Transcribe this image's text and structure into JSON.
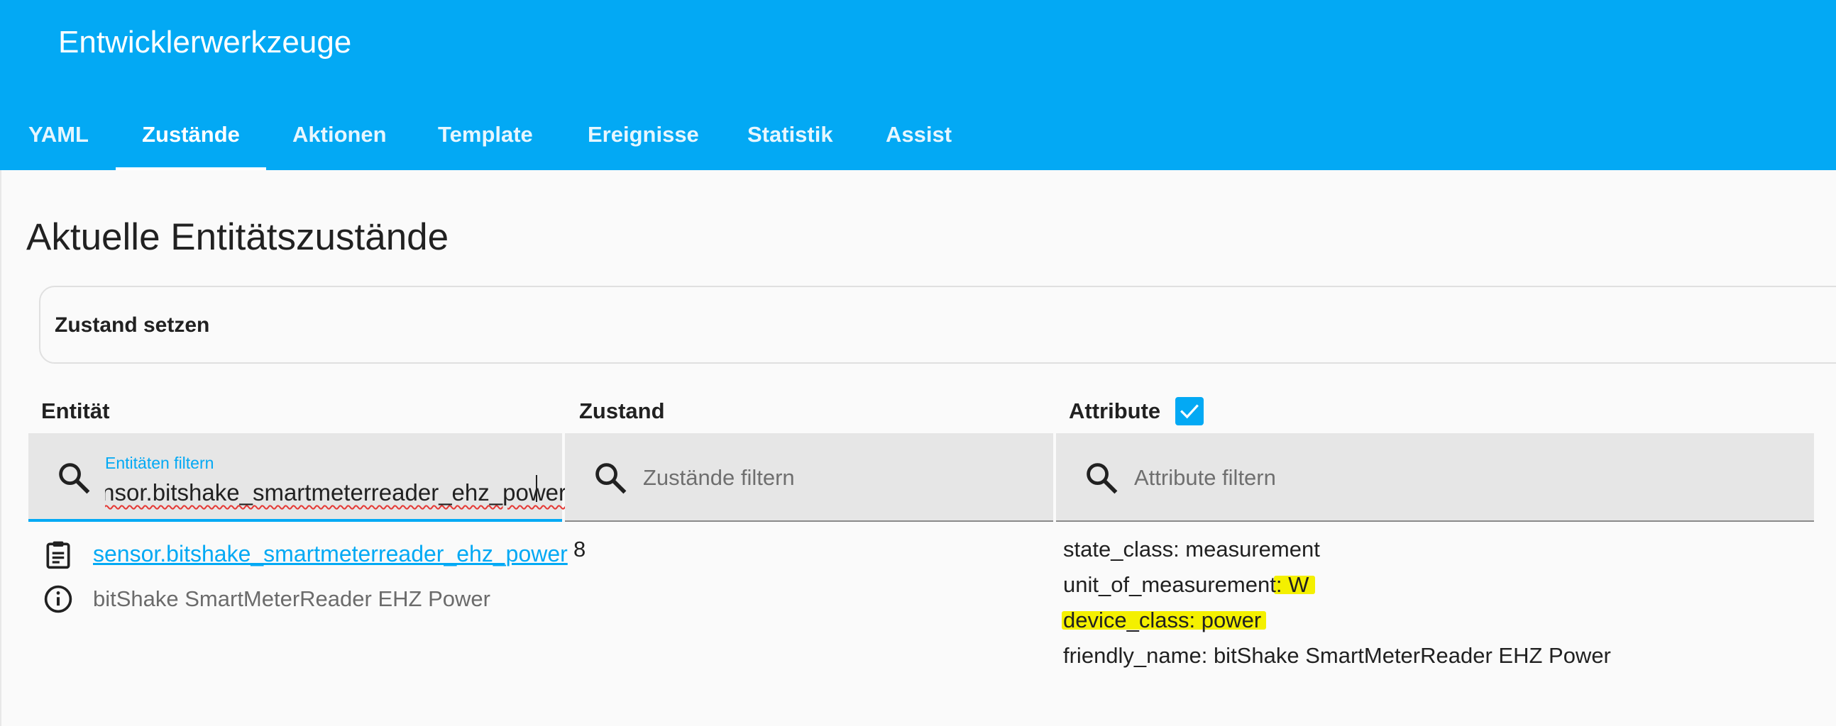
{
  "header": {
    "title": "Entwicklerwerkzeuge",
    "tabs": [
      {
        "label": "YAML",
        "active": false
      },
      {
        "label": "Zustände",
        "active": true
      },
      {
        "label": "Aktionen",
        "active": false
      },
      {
        "label": "Template",
        "active": false
      },
      {
        "label": "Ereignisse",
        "active": false
      },
      {
        "label": "Statistik",
        "active": false
      },
      {
        "label": "Assist",
        "active": false
      }
    ]
  },
  "page": {
    "title": "Aktuelle Entitätszustände",
    "set_state_label": "Zustand setzen"
  },
  "table": {
    "columns": {
      "entity": "Entität",
      "state": "Zustand",
      "attributes": "Attribute"
    },
    "attributes_checkbox_checked": true,
    "filters": {
      "entity": {
        "label": "Entitäten filtern",
        "value": "sensor.bitshake_smartmeterreader_ehz_power"
      },
      "state": {
        "placeholder": "Zustände filtern"
      },
      "attributes": {
        "placeholder": "Attribute filtern"
      }
    },
    "rows": [
      {
        "entity_id": "sensor.bitshake_smartmeterreader_ehz_power",
        "friendly_name": "bitShake SmartMeterReader EHZ Power",
        "state": "8",
        "attributes": [
          "state_class: measurement",
          "unit_of_measurement: W",
          "device_class: power",
          "friendly_name: bitShake SmartMeterReader EHZ Power"
        ]
      }
    ]
  },
  "colors": {
    "primary": "#03a9f4",
    "highlight": "#f4f000"
  },
  "icons": {
    "search": "magnify-icon",
    "copy": "clipboard-text-icon",
    "info": "information-outline-icon",
    "check": "check-icon"
  }
}
